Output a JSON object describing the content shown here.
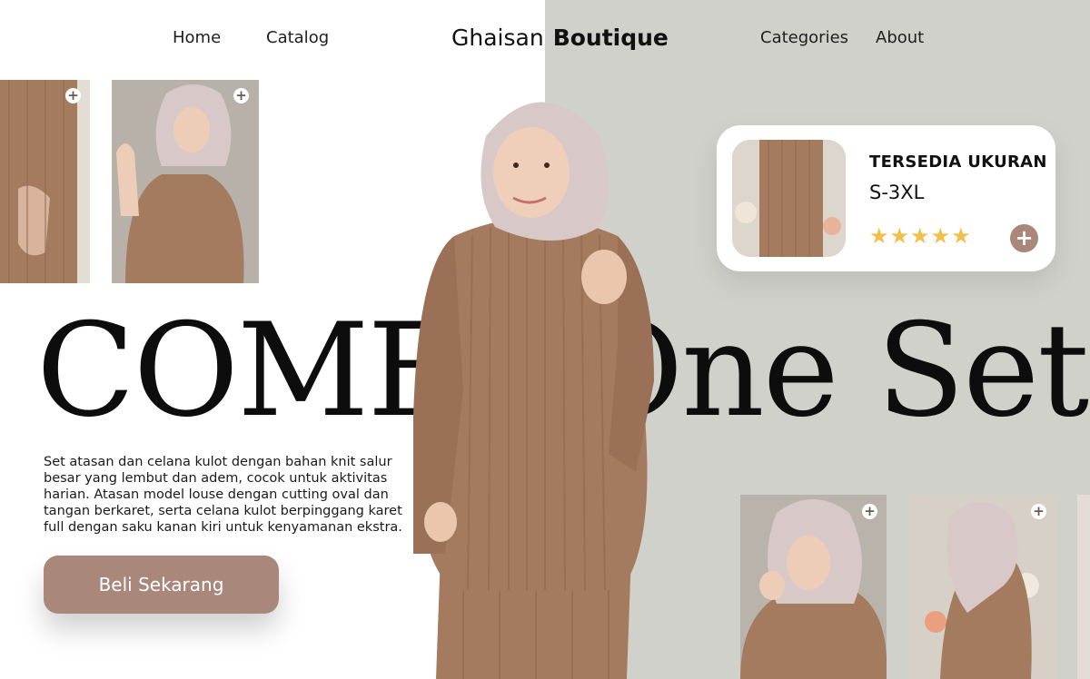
{
  "nav": {
    "home": "Home",
    "catalog": "Catalog",
    "logo_first": "Ghaisan",
    "logo_second": "Boutique",
    "categories": "Categories",
    "about": "About"
  },
  "hero": {
    "title": "COMFY One Set",
    "description": "Set atasan dan celana kulot dengan bahan knit salur besar yang lembut dan adem, cocok untuk aktivitas harian. Atasan model louse dengan cutting oval dan tangan berkaret, serta celana kulot berpinggang karet full dengan saku kanan kiri untuk kenyamanan ekstra.",
    "cta": "Beli Sekarang"
  },
  "card": {
    "title": "TERSEDIA UKURAN",
    "size": "S-3XL",
    "rating": 5,
    "stars": "★★★★★"
  },
  "icons": {
    "plus": "+"
  },
  "colors": {
    "accent": "#a9877a",
    "background_right": "#d1d1cc",
    "star": "#f2bf4a",
    "garment": "#a47b5f",
    "hijab": "#d8c9c8"
  }
}
